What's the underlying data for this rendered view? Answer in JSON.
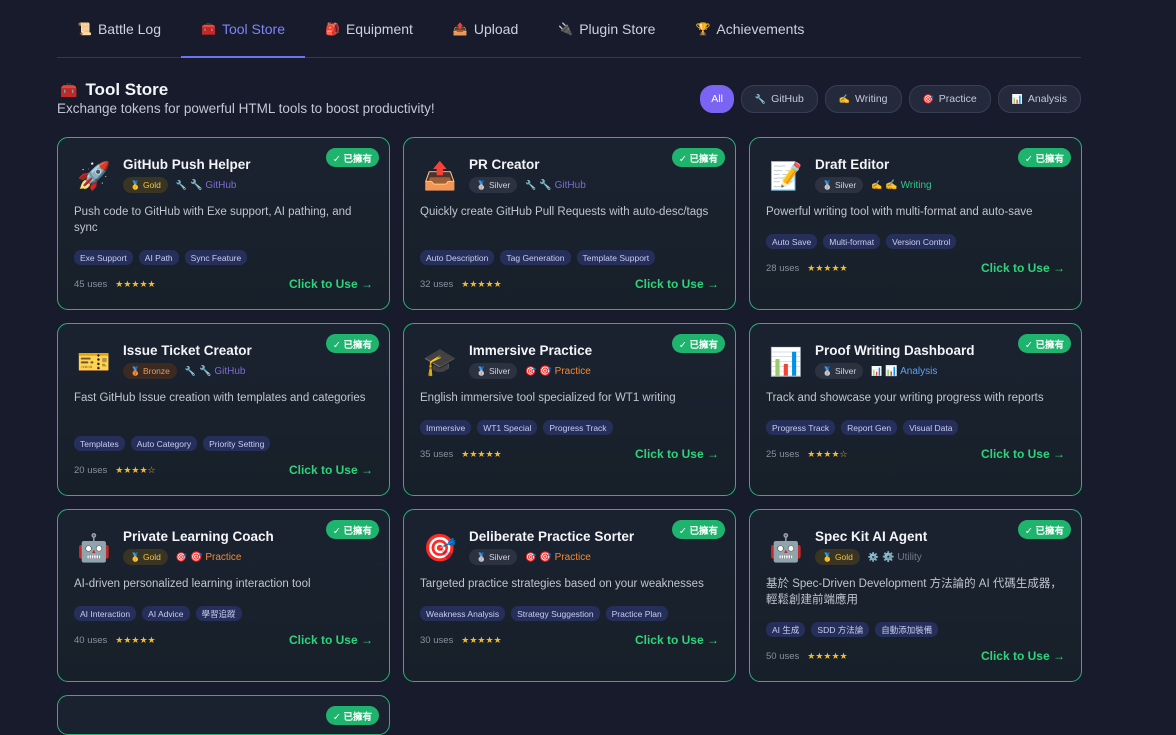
{
  "tabs": [
    {
      "icon": "📜",
      "label": "Battle Log",
      "active": false
    },
    {
      "icon": "🧰",
      "label": "Tool Store",
      "active": true
    },
    {
      "icon": "🎒",
      "label": "Equipment",
      "active": false
    },
    {
      "icon": "📤",
      "label": "Upload",
      "active": false
    },
    {
      "icon": "🔌",
      "label": "Plugin Store",
      "active": false
    },
    {
      "icon": "🏆",
      "label": "Achievements",
      "active": false
    }
  ],
  "section": {
    "icon": "🧰",
    "title": "Tool Store",
    "subtitle": "Exchange tokens for powerful HTML tools to boost productivity!"
  },
  "filters": [
    {
      "icon": "",
      "label": "All",
      "active": true
    },
    {
      "icon": "🔧",
      "label": "GitHub",
      "active": false
    },
    {
      "icon": "✍️",
      "label": "Writing",
      "active": false
    },
    {
      "icon": "🎯",
      "label": "Practice",
      "active": false
    },
    {
      "icon": "📊",
      "label": "Analysis",
      "active": false
    }
  ],
  "owned_label": "✓ 已擁有",
  "cta_label": "Click to Use →",
  "cards": [
    {
      "icon": "🚀",
      "name": "GitHub Push Helper",
      "tier": "🥇 Gold",
      "tier_class": "gold",
      "cat_icon": "🔧",
      "cat": "🔧 GitHub",
      "cat_class": "github",
      "desc": "Push code to GitHub with Exe support, AI pathing, and sync",
      "tags": [
        "Exe Support",
        "AI Path",
        "Sync Feature"
      ],
      "uses": "45 uses",
      "stars": "★★★★★"
    },
    {
      "icon": "📤",
      "name": "PR Creator",
      "tier": "🥈 Silver",
      "tier_class": "silver",
      "cat_icon": "🔧",
      "cat": "🔧 GitHub",
      "cat_class": "github",
      "desc": "Quickly create GitHub Pull Requests with auto-desc/tags",
      "tags": [
        "Auto Description",
        "Tag Generation",
        "Template Support"
      ],
      "uses": "32 uses",
      "stars": "★★★★★"
    },
    {
      "icon": "📝",
      "name": "Draft Editor",
      "tier": "🥈 Silver",
      "tier_class": "silver",
      "cat_icon": "✍️",
      "cat": "✍️ Writing",
      "cat_class": "writing",
      "desc": "Powerful writing tool with multi-format and auto-save",
      "tags": [
        "Auto Save",
        "Multi-format",
        "Version Control"
      ],
      "uses": "28 uses",
      "stars": "★★★★★"
    },
    {
      "icon": "🎫",
      "name": "Issue Ticket Creator",
      "tier": "🥉 Bronze",
      "tier_class": "bronze",
      "cat_icon": "🔧",
      "cat": "🔧 GitHub",
      "cat_class": "github",
      "desc": "Fast GitHub Issue creation with templates and categories",
      "tags": [
        "Templates",
        "Auto Category",
        "Priority Setting"
      ],
      "uses": "20 uses",
      "stars": "★★★★☆"
    },
    {
      "icon": "🎓",
      "name": "Immersive Practice",
      "tier": "🥈 Silver",
      "tier_class": "silver",
      "cat_icon": "🎯",
      "cat": "🎯 Practice",
      "cat_class": "practice",
      "desc": "English immersive tool specialized for WT1 writing",
      "tags": [
        "Immersive",
        "WT1 Special",
        "Progress Track"
      ],
      "uses": "35 uses",
      "stars": "★★★★★"
    },
    {
      "icon": "📊",
      "name": "Proof Writing Dashboard",
      "tier": "🥈 Silver",
      "tier_class": "silver",
      "cat_icon": "📊",
      "cat": "📊 Analysis",
      "cat_class": "analysis",
      "desc": "Track and showcase your writing progress with reports",
      "tags": [
        "Progress Track",
        "Report Gen",
        "Visual Data"
      ],
      "uses": "25 uses",
      "stars": "★★★★☆"
    },
    {
      "icon": "🤖",
      "name": "Private Learning Coach",
      "tier": "🥇 Gold",
      "tier_class": "gold",
      "cat_icon": "🎯",
      "cat": "🎯 Practice",
      "cat_class": "practice",
      "desc": "AI-driven personalized learning interaction tool",
      "tags": [
        "AI Interaction",
        "AI Advice",
        "學習追蹤"
      ],
      "uses": "40 uses",
      "stars": "★★★★★"
    },
    {
      "icon": "🎯",
      "name": "Deliberate Practice Sorter",
      "tier": "🥈 Silver",
      "tier_class": "silver",
      "cat_icon": "🎯",
      "cat": "🎯 Practice",
      "cat_class": "practice",
      "desc": "Targeted practice strategies based on your weaknesses",
      "tags": [
        "Weakness Analysis",
        "Strategy Suggestion",
        "Practice Plan"
      ],
      "uses": "30 uses",
      "stars": "★★★★★"
    },
    {
      "icon": "🤖",
      "name": "Spec Kit AI Agent",
      "tier": "🥇 Gold",
      "tier_class": "gold",
      "cat_icon": "⚙️",
      "cat": "⚙️ Utility",
      "cat_class": "utility",
      "desc": "基於 Spec-Driven Development 方法論的 AI 代碼生成器，輕鬆創建前端應用",
      "tags": [
        "AI 生成",
        "SDD 方法論",
        "自動添加裝備"
      ],
      "uses": "50 uses",
      "stars": "★★★★★"
    }
  ]
}
